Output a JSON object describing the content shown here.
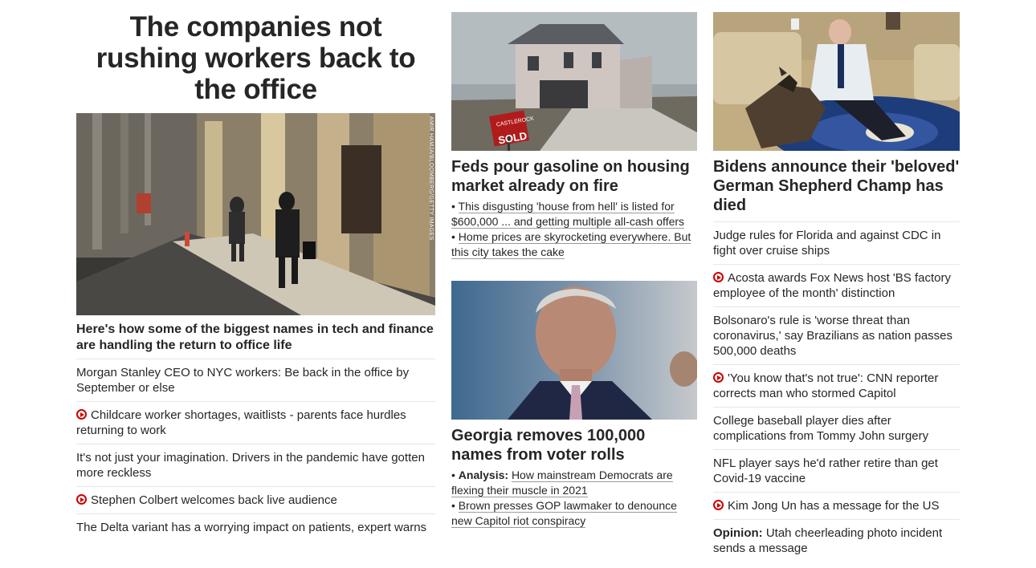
{
  "col1": {
    "headline": "The companies not rushing workers back to the office",
    "image_credit": "AMIR HAMJA/BLOOMBERG/GETTY IMAGES",
    "lead": "Here's how some of the biggest names in tech and finance are handling the return to office life",
    "items": [
      {
        "text": "Morgan Stanley CEO to NYC workers: Be back in the office by September or else",
        "video": false
      },
      {
        "text": "Childcare worker shortages, waitlists - parents face hurdles returning to work",
        "video": true
      },
      {
        "text": "It's not just your imagination. Drivers in the pandemic have gotten more reckless",
        "video": false
      },
      {
        "text": "Stephen Colbert welcomes back live audience",
        "video": true
      },
      {
        "text": "The Delta variant has a worrying impact on patients, expert warns",
        "video": false
      }
    ]
  },
  "col2": {
    "story1": {
      "image_sign_top": "CASTLEROCK",
      "image_sign": "SOLD",
      "headline": "Feds pour gasoline on housing market already on fire",
      "bullets": [
        {
          "prefix": "",
          "text": "This disgusting 'house from hell' is listed for $600,000 ... and getting multiple all-cash offers"
        },
        {
          "prefix": "",
          "text": "Home prices are skyrocketing everywhere. But this city takes the cake"
        }
      ]
    },
    "story2": {
      "headline": "Georgia removes 100,000 names from voter rolls",
      "bullets": [
        {
          "prefix": "Analysis:",
          "text": "How mainstream Democrats are flexing their muscle in 2021"
        },
        {
          "prefix": "",
          "text": "Brown presses GOP lawmaker to denounce new Capitol riot conspiracy"
        }
      ]
    }
  },
  "col3": {
    "headline": "Bidens announce their 'beloved' German Shepherd Champ has died",
    "items": [
      {
        "text": "Judge rules for Florida and against CDC in fight over cruise ships",
        "video": false,
        "prefix": ""
      },
      {
        "text": "Acosta awards Fox News host 'BS factory employee of the month' distinction",
        "video": true,
        "prefix": ""
      },
      {
        "text": "Bolsonaro's rule is 'worse threat than coronavirus,' say Brazilians as nation passes 500,000 deaths",
        "video": false,
        "prefix": ""
      },
      {
        "text": "'You know that's not true': CNN reporter corrects man who stormed Capitol",
        "video": true,
        "prefix": ""
      },
      {
        "text": "College baseball player dies after complications from Tommy John surgery",
        "video": false,
        "prefix": ""
      },
      {
        "text": "NFL player says he'd rather retire than get Covid-19 vaccine",
        "video": false,
        "prefix": ""
      },
      {
        "text": "Kim Jong Un has a message for the US",
        "video": true,
        "prefix": ""
      },
      {
        "text": "Utah cheerleading photo incident sends a message",
        "video": false,
        "prefix": "Opinion:"
      }
    ]
  },
  "colors": {
    "accent_red": "#cc0000",
    "text": "#262626",
    "divider": "#e6e6e6"
  }
}
